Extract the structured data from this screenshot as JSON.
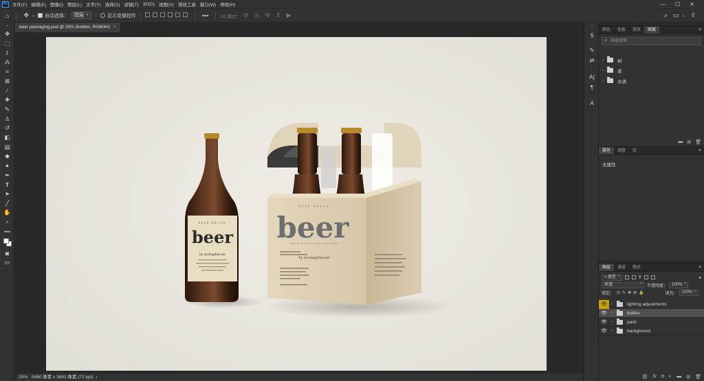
{
  "app": {
    "logo_text": "Ps"
  },
  "menu": [
    "文件(F)",
    "编辑(E)",
    "图像(I)",
    "图层(L)",
    "文字(Y)",
    "选择(S)",
    "滤镜(T)",
    "3D(D)",
    "视图(V)",
    "增效工具",
    "窗口(W)",
    "帮助(H)"
  ],
  "window_controls": {
    "minimize": "—",
    "maximize": "☐",
    "close": "✕"
  },
  "options": {
    "auto_select_label": "自动选择：",
    "auto_select_value": "图层",
    "show_transform_label": "显示变换控件",
    "mode_label": "3D 模式："
  },
  "document": {
    "tab_title": "beer packaging.psd @ 25% (bottles, RGB/8#)",
    "tab_close": "×"
  },
  "status": {
    "zoom": "25%",
    "info": "5460 像素 x 3642 像素 (72 ppi)",
    "arrow": "›"
  },
  "mockup": {
    "bottle_label_title": "beer",
    "bottle_label_top": "BEER BRAND",
    "bottle_label_url": "by mockupfree.net",
    "pack_title": "beer",
    "pack_top": "BEER BRAND",
    "pack_sub": "BEER PACKAGING MOCKUP",
    "pack_url": "by mockupfree.net"
  },
  "libraries": {
    "tabs": [
      "颜色",
      "色板",
      "渐变",
      "图案"
    ],
    "active_tab": 3,
    "search_placeholder": "搜索图案",
    "items": [
      "树",
      "草",
      "水滴"
    ]
  },
  "properties": {
    "tabs": [
      "属性",
      "调整",
      "库"
    ],
    "active_tab": 0,
    "empty_text": "无属性"
  },
  "layers_panel": {
    "tabs": [
      "图层",
      "通道",
      "路径"
    ],
    "active_tab": 0,
    "kind_filter": "类型",
    "blend_mode": "穿透",
    "opacity_label": "不透明度：",
    "opacity_value": "100%",
    "lock_label": "锁定：",
    "fill_label": "填充：",
    "fill_value": "100%",
    "layers": [
      {
        "name": "lighting adjustments",
        "selected": false,
        "eye_highlight": true
      },
      {
        "name": "bottles",
        "selected": true,
        "eye_highlight": false
      },
      {
        "name": "pack",
        "selected": false,
        "eye_highlight": false
      },
      {
        "name": "background",
        "selected": false,
        "eye_highlight": false
      }
    ]
  },
  "colors": {
    "accent": "#31a8ff",
    "panel_bg": "#323232",
    "canvas_bg": "#ebe8e1",
    "eye_highlight": "#c4a000",
    "selected_layer": "#4f4f4f"
  }
}
